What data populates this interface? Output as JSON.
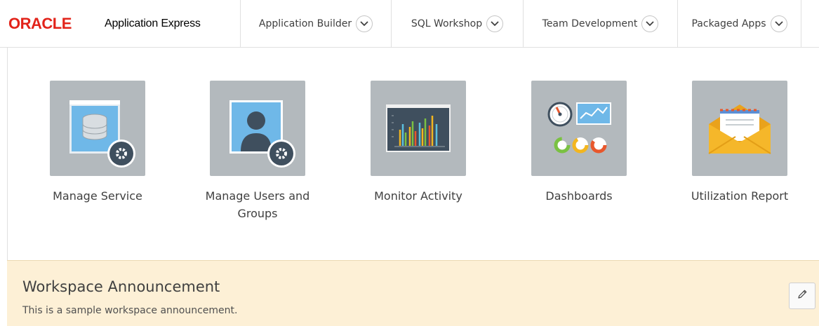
{
  "header": {
    "logo_text": "ORACLE",
    "app_name": "Application Express",
    "tabs": [
      {
        "label": "Application Builder"
      },
      {
        "label": "SQL Workshop"
      },
      {
        "label": "Team Development"
      },
      {
        "label": "Packaged Apps"
      }
    ]
  },
  "tiles": [
    {
      "label": "Manage Service",
      "icon": "database-settings-icon"
    },
    {
      "label": "Manage Users and Groups",
      "icon": "user-settings-icon"
    },
    {
      "label": "Monitor Activity",
      "icon": "bar-chart-icon"
    },
    {
      "label": "Dashboards",
      "icon": "dashboard-icon"
    },
    {
      "label": "Utilization Report",
      "icon": "envelope-icon"
    }
  ],
  "announcement": {
    "title": "Workspace Announcement",
    "text": "This is a sample workspace announcement."
  },
  "colors": {
    "oracle_red": "#e2231a",
    "tile_bg": "#b3b9bd",
    "announcement_bg": "#fdf0d6"
  }
}
